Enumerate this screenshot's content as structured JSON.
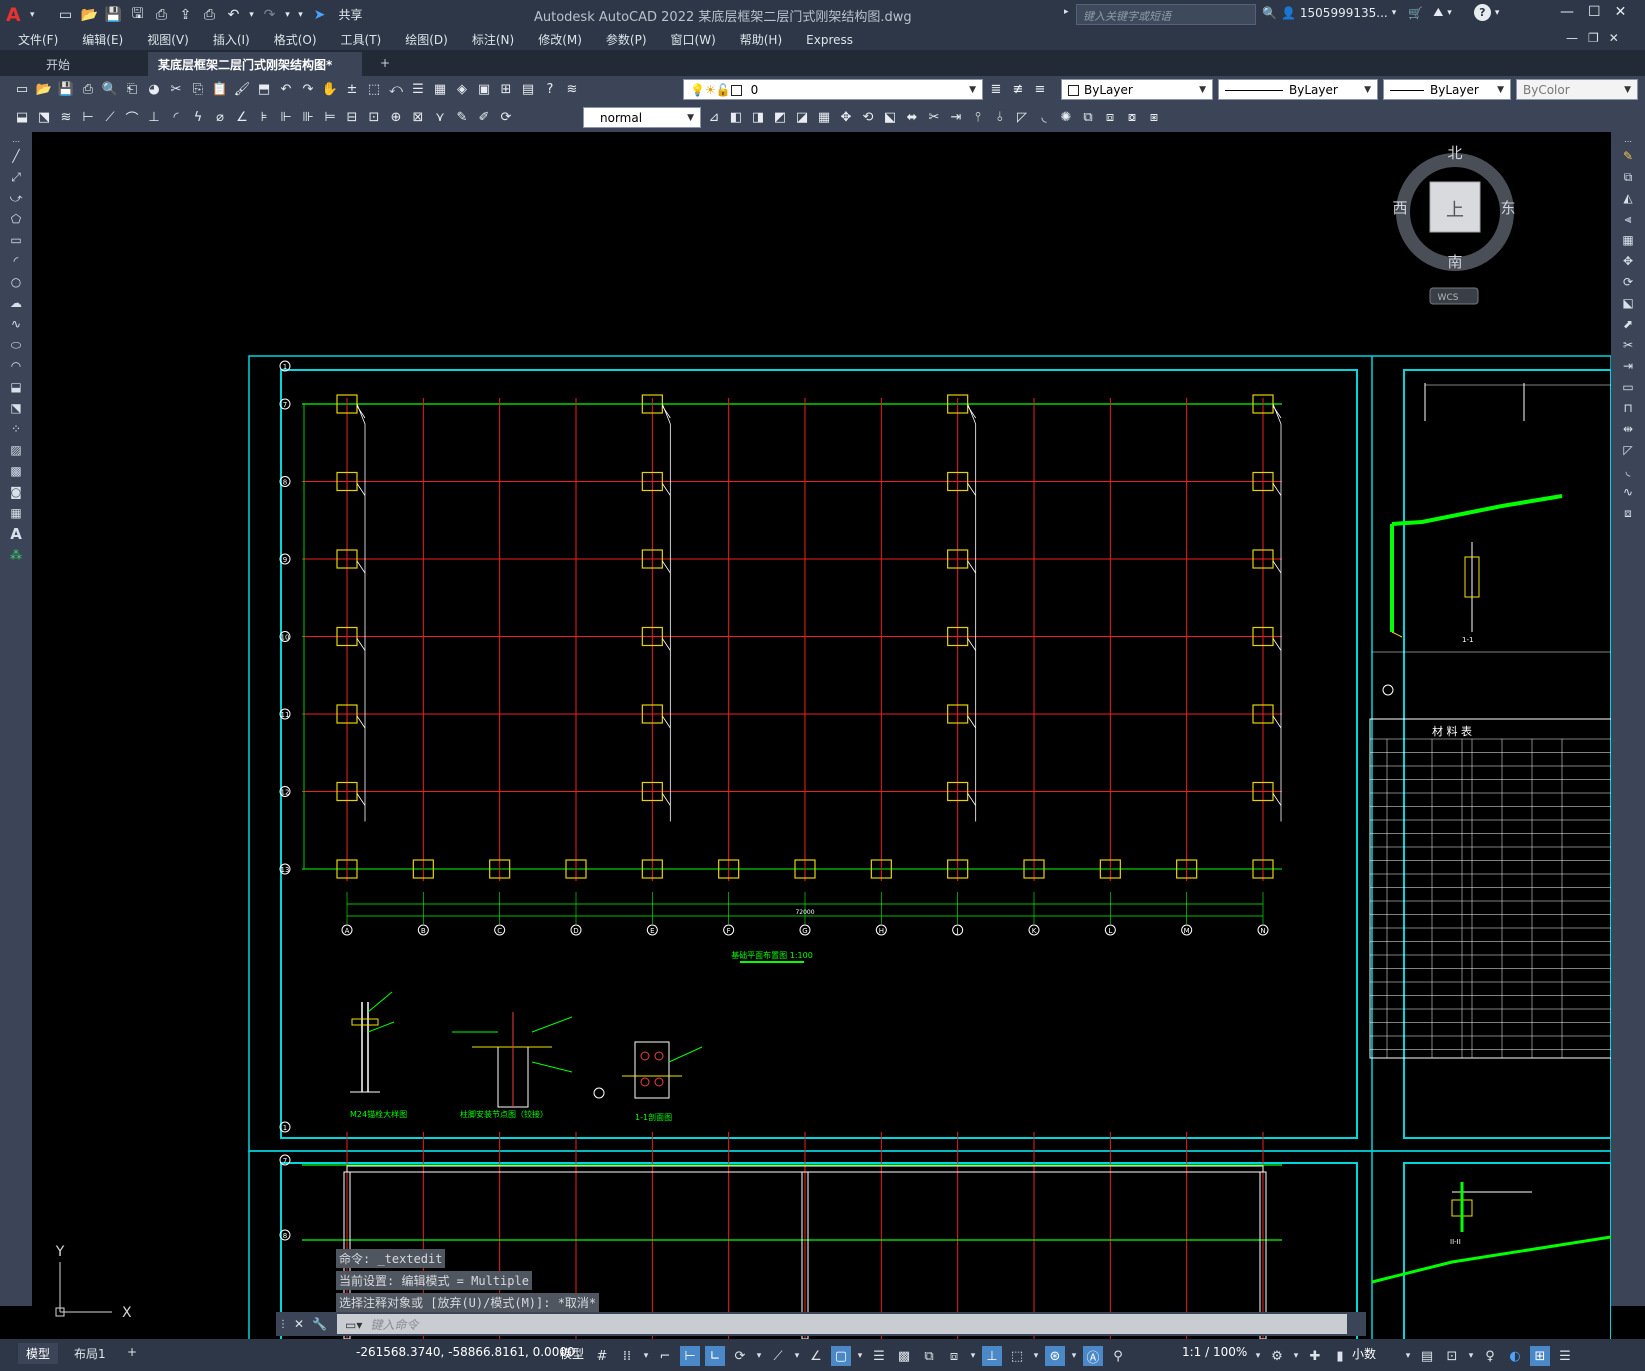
{
  "app": {
    "logo": "A",
    "title": "Autodesk AutoCAD 2022    某底层框架二层门式刚架结构图.dwg",
    "share_label": "共享",
    "search_placeholder": "键入关键字或短语",
    "user_label": "1505999135...",
    "help_label": "?"
  },
  "menu": [
    "文件(F)",
    "编辑(E)",
    "视图(V)",
    "插入(I)",
    "格式(O)",
    "工具(T)",
    "绘图(D)",
    "标注(N)",
    "修改(M)",
    "参数(P)",
    "窗口(W)",
    "帮助(H)",
    "Express"
  ],
  "tabs": {
    "start": "开始",
    "doc": "某底层框架二层门式刚架结构图*",
    "close": "×",
    "add": "+"
  },
  "toolbar": {
    "layer_value": "0",
    "color_value": "ByLayer",
    "linetype_value": "ByLayer",
    "lineweight_value": "ByLayer",
    "plotstyle_value": "ByColor",
    "textstyle_value": "normal"
  },
  "viewcube": {
    "north": "北",
    "south": "南",
    "east": "东",
    "west": "西",
    "face": "上",
    "wcs": "WCS"
  },
  "ucs": {
    "x": "X",
    "y": "Y"
  },
  "command": {
    "history": [
      "命令: _textedit",
      "当前设置: 编辑模式 = Multiple",
      "选择注释对象或 [放弃(U)/模式(M)]: *取消*"
    ],
    "placeholder": "键入命令"
  },
  "status": {
    "model_tab": "模型",
    "layout_tab": "布局1",
    "add": "+",
    "coords": "-261568.3740, -58866.8161, 0.0000",
    "space": "模型",
    "scale": "1:1 / 100%",
    "units": "小数"
  },
  "drawing": {
    "plan_rows": [
      "1",
      "7",
      "8",
      "9",
      "10",
      "11",
      "12",
      "13"
    ],
    "plan_cols": [
      "A",
      "B",
      "C",
      "D",
      "E",
      "F",
      "G",
      "H",
      "J",
      "K",
      "L",
      "M",
      "N"
    ],
    "plan_title": "基础平面布置图 1:100",
    "detail_titles": [
      "M24锚栓大样图",
      "柱脚安装节点图（铰接）",
      "1-1剖面图"
    ],
    "elev_rows": [
      "1",
      "7",
      "8"
    ],
    "table_title": "材 料 表",
    "side_section_1": "1-1",
    "side_section_2": "II-II",
    "total_dim": "72000"
  }
}
